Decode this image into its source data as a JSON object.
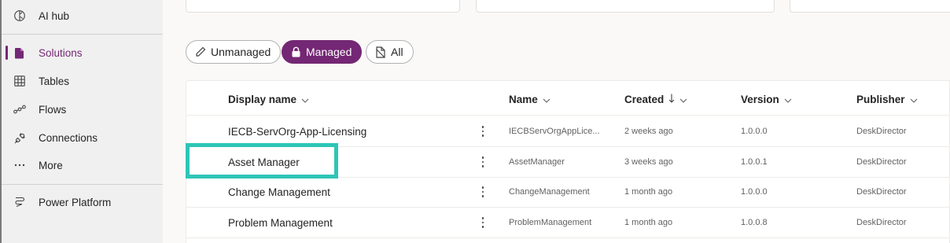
{
  "nav": {
    "items": [
      {
        "label": "AI hub",
        "icon": "brain-icon"
      },
      {
        "label": "Solutions",
        "icon": "solutions-icon",
        "active": true
      },
      {
        "label": "Tables",
        "icon": "table-grid-icon"
      },
      {
        "label": "Flows",
        "icon": "flows-icon"
      },
      {
        "label": "Connections",
        "icon": "plug-icon"
      },
      {
        "label": "More",
        "icon": "ellipsis-icon"
      },
      {
        "label": "Power Platform",
        "icon": "power-platform-icon"
      }
    ]
  },
  "filters": {
    "unmanaged": "Unmanaged",
    "managed": "Managed",
    "all": "All",
    "selected": "Managed"
  },
  "table": {
    "columns": {
      "display_name": "Display name",
      "name": "Name",
      "created": "Created",
      "version": "Version",
      "publisher": "Publisher"
    },
    "sort": {
      "column": "Created",
      "direction": "descending"
    },
    "rows": [
      {
        "display_name": "IECB-ServOrg-App-Licensing",
        "name": "IECBServOrgAppLice...",
        "created": "2 weeks ago",
        "version": "1.0.0.0",
        "publisher": "DeskDirector"
      },
      {
        "display_name": "Asset Manager",
        "name": "AssetManager",
        "created": "3 weeks ago",
        "version": "1.0.0.1",
        "publisher": "DeskDirector",
        "highlighted": true
      },
      {
        "display_name": "Change Management",
        "name": "ChangeManagement",
        "created": "1 month ago",
        "version": "1.0.0.0",
        "publisher": "DeskDirector"
      },
      {
        "display_name": "Problem Management",
        "name": "ProblemManagement",
        "created": "1 month ago",
        "version": "1.0.0.8",
        "publisher": "DeskDirector"
      }
    ]
  },
  "colors": {
    "accent": "#742774",
    "highlight": "#2ec5b6"
  }
}
